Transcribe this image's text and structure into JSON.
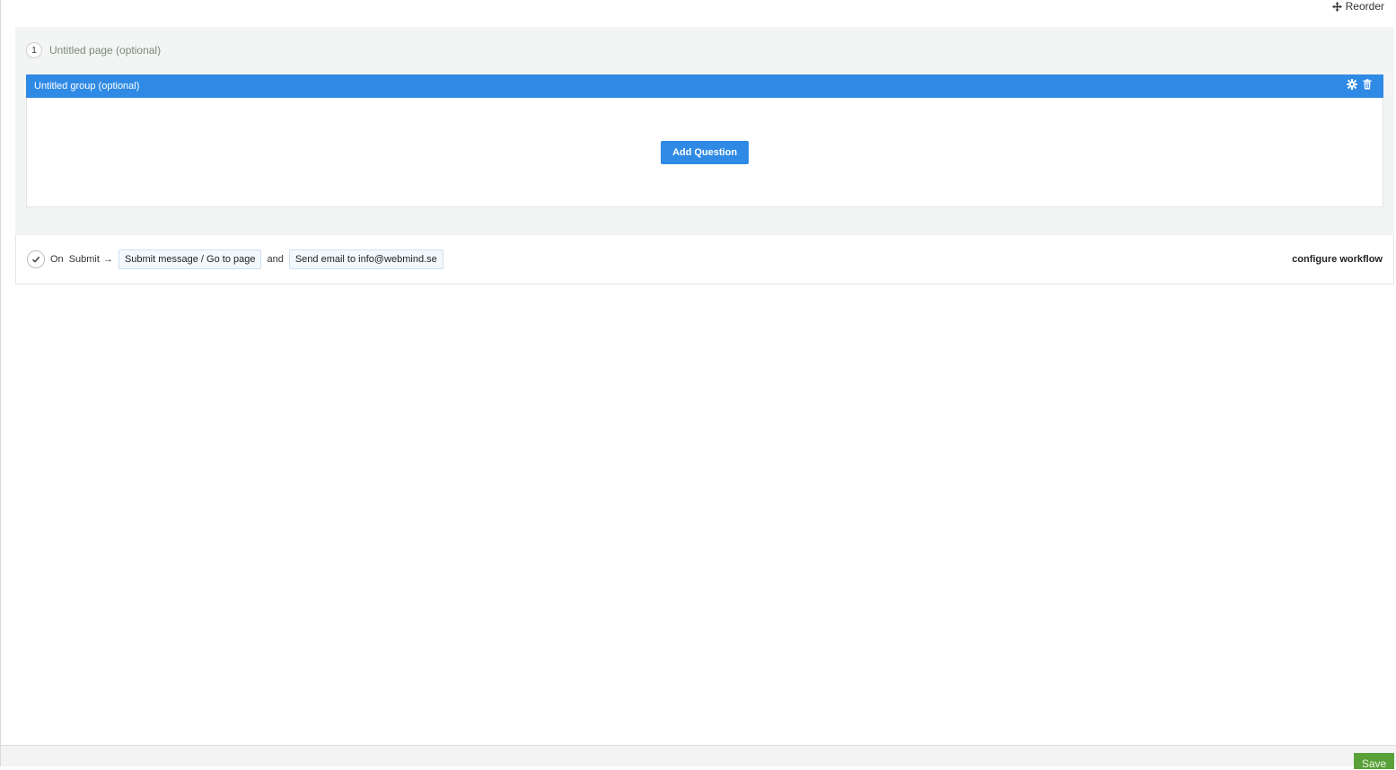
{
  "toolbar": {
    "reorder_label": "Reorder",
    "reorder_icon": "move-icon"
  },
  "page": {
    "number": "1",
    "title": "Untitled page (optional)"
  },
  "group": {
    "title": "Untitled group (optional)",
    "settings_icon": "gear-icon",
    "delete_icon": "trash-icon",
    "add_question_label": "Add Question"
  },
  "workflow": {
    "on_label": "On",
    "submit_label": "Submit",
    "arrow": "→",
    "action_1": "Submit message / Go to page",
    "and_label": "and",
    "action_2": "Send email to info@webmind.se",
    "configure_label": "configure workflow"
  },
  "footer": {
    "save_label": "Save"
  },
  "colors": {
    "accent": "#2f8ae5",
    "save": "#5aa13a",
    "panel_bg": "#f3f4f4"
  }
}
